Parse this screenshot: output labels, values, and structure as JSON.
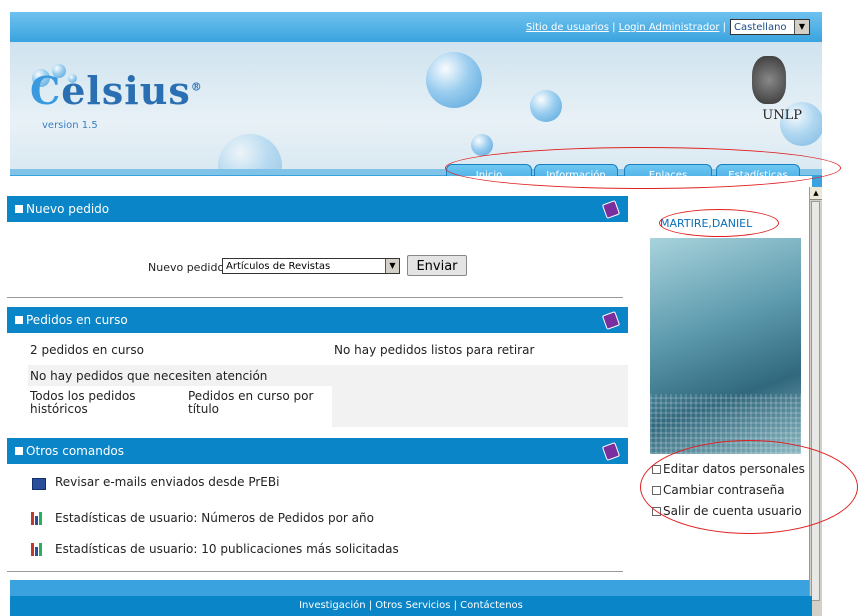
{
  "top_links": {
    "users_site": "Sitio de usuarios",
    "separator": "|",
    "admin_login": "Login Administrador",
    "language": "Castellano"
  },
  "logo": {
    "name": "elsius",
    "letter": "C",
    "registered": "®",
    "version": "version 1.5",
    "institution": "UNLP"
  },
  "tabs": [
    {
      "label": "Inicio"
    },
    {
      "label": "Información"
    },
    {
      "label": "Enlaces"
    },
    {
      "label": "Estadísticas"
    }
  ],
  "new_order": {
    "title": "Nuevo pedido",
    "field_label": "Nuevo pedido",
    "selected_option": "Artículos de Revistas",
    "submit": "Enviar"
  },
  "orders_in_progress": {
    "title": "Pedidos en curso",
    "count_text": "2 pedidos en curso",
    "ready_text": "No hay pedidos listos para retirar",
    "attention_text": "No hay pedidos que necesiten atención",
    "history_link": "Todos los pedidos históricos",
    "by_title_link": "Pedidos en curso por título"
  },
  "other_commands": {
    "title": "Otros comandos",
    "items": [
      {
        "label": "Revisar e-mails enviados desde PrEBi",
        "icon": "mail-icon"
      },
      {
        "label": "Estadísticas de usuario: Números de Pedidos por año",
        "icon": "bar-chart-icon"
      },
      {
        "label": "Estadísticas de usuario: 10 publicaciones más solicitadas",
        "icon": "bar-chart-icon"
      }
    ]
  },
  "user": {
    "name": "MARTIRE,DANIEL",
    "links": [
      "Editar datos personales",
      "Cambiar contraseña",
      "Salir de cuenta usuario"
    ]
  },
  "footer": {
    "text": "Investigación | Otros Servicios | Contáctenos"
  },
  "colors": {
    "header_blue": "#0a85c8",
    "frame_blue": "#3aa3df",
    "annotation_red": "#e02020"
  }
}
